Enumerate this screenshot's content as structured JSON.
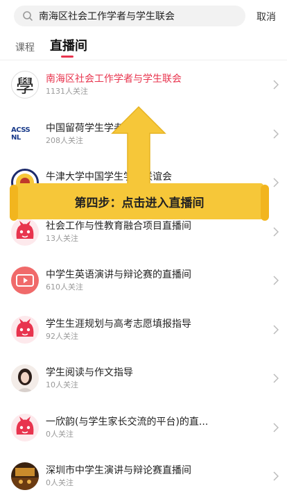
{
  "search": {
    "query": "南海区社会工作学者与学生联会",
    "cancel_label": "取消"
  },
  "tabs": [
    {
      "label": "课程",
      "active": false
    },
    {
      "label": "直播间",
      "active": true
    }
  ],
  "list": [
    {
      "title": "南海区社会工作学者与学生联会",
      "followers": "1131人关注",
      "avatar": "xue-logo",
      "avatar_text": "學",
      "highlighted": true
    },
    {
      "title": "中国留荷学生学者联合会",
      "followers": "208人关注",
      "avatar": "acss-logo",
      "avatar_text": "ACSS NL"
    },
    {
      "title": "牛津大学中国学生学者联谊会",
      "followers": "",
      "avatar": "oxford-logo"
    },
    {
      "title": "社会工作与性教育融合项目直播间",
      "followers": "13人关注",
      "avatar": "red-mascot"
    },
    {
      "title": "中学生英语演讲与辩论赛的直播间",
      "followers": "610人关注",
      "avatar": "video-icon"
    },
    {
      "title": "学生生涯规划与高考志愿填报指导",
      "followers": "92人关注",
      "avatar": "red-mascot"
    },
    {
      "title": "学生阅读与作文指导",
      "followers": "10人关注",
      "avatar": "girl-photo"
    },
    {
      "title": "一欣韵(与学生家长交流的平台)的直...",
      "followers": "0人关注",
      "avatar": "red-mascot"
    },
    {
      "title": "深圳市中学生演讲与辩论赛直播间",
      "followers": "0人关注",
      "avatar": "stage-photo"
    }
  ],
  "overlay": {
    "banner_text": "第四步：点击进入直播间"
  },
  "colors": {
    "accent": "#e8344e",
    "banner": "#f6c739",
    "arrow": "#f6c739"
  }
}
